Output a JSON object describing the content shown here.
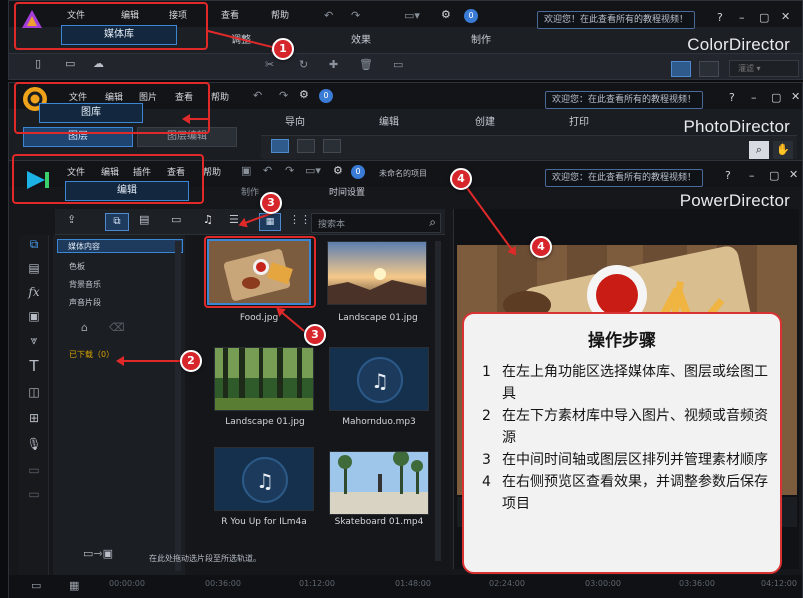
{
  "color_director": {
    "menu": [
      "文件",
      "编辑",
      "接项",
      "查看",
      "帮助"
    ],
    "tab": "媒体库",
    "tabs_right": [
      "调整",
      "效果",
      "制作"
    ],
    "welcome": "欢迎您！在此查看所有的教程视频！",
    "brand": "ColorDirector",
    "mode_select": "灌滤",
    "info_badge": "0"
  },
  "photo_director": {
    "menu": [
      "文件",
      "编辑",
      "图片",
      "查看",
      "帮助"
    ],
    "tab": "图库",
    "tabs_right": [
      "导向",
      "编辑",
      "创建",
      "打印"
    ],
    "tab_row2": [
      "图层",
      "图层编辑"
    ],
    "welcome": "欢迎您：在此查看所有的教程视频！",
    "brand": "PhotoDirector",
    "info_badge": "0"
  },
  "power_director": {
    "menu": [
      "文件",
      "编辑",
      "插件",
      "查看",
      "帮助"
    ],
    "tab": "编辑",
    "project_name": "未命名的项目",
    "subtabs": [
      "制作",
      "时间设置"
    ],
    "welcome": "欢迎您：在此查看所有的教程视频！",
    "brand": "PowerDirector",
    "info_badge": "0",
    "search_placeholder": "搜索本",
    "library_tree": [
      "媒体内容",
      "色板",
      "背景音乐",
      "声音片段"
    ],
    "download_label": "已下载（0）",
    "media": [
      {
        "name": "Food.jpg",
        "kind": "image"
      },
      {
        "name": "Landscape 01.jpg",
        "kind": "image"
      },
      {
        "name": "Landscape 01.jpg",
        "kind": "image"
      },
      {
        "name": "Mahornduo.mp3",
        "kind": "audio"
      },
      {
        "name": "R You Up for ILm4a",
        "kind": "audio"
      },
      {
        "name": "Skateboard 01.mp4",
        "kind": "image"
      }
    ],
    "status_hint": "在此处拖动选片段至所选轨道。",
    "timeline_ticks": [
      "00:00:00",
      "00:36:00",
      "01:12:00",
      "01:48:00",
      "02:24:00",
      "03:00:00",
      "03:36:00",
      "04:12:00"
    ]
  },
  "callouts": [
    "1",
    "2",
    "3",
    "3",
    "4",
    "4"
  ],
  "steps": {
    "title": "操作步骤",
    "items": [
      {
        "n": "1",
        "text": "在左上角功能区选择媒体库、图层或绘图工具"
      },
      {
        "n": "2",
        "text": "在左下方素材库中导入图片、视频或音频资源"
      },
      {
        "n": "3",
        "text": "在中间时间轴或图层区排列并管理素材顺序"
      },
      {
        "n": "4",
        "text": "在右侧预览区查看效果，并调整参数后保存项目"
      }
    ]
  },
  "colors": {
    "accent_blue": "#3c86d6",
    "callout_red": "#e02a2a",
    "bg": "#15171b"
  }
}
